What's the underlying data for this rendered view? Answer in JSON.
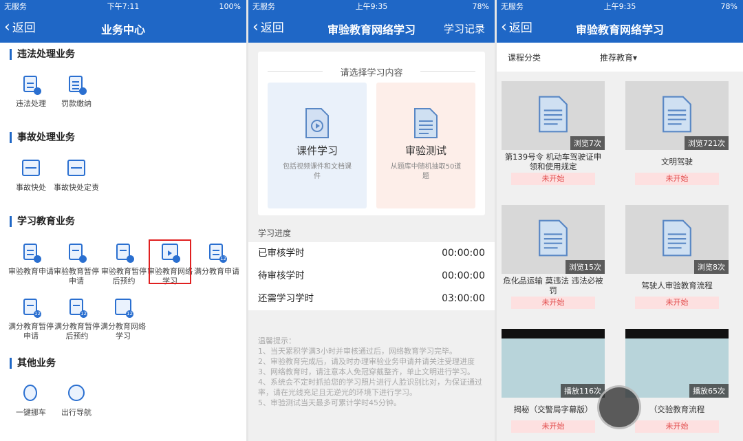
{
  "watermark": "youchejiuxing.com 有车就行",
  "s1": {
    "status": {
      "carrier": "无服务",
      "time": "下午7:11",
      "battery": "100%"
    },
    "nav": {
      "back": "返回",
      "title": "业务中心"
    },
    "sections": [
      {
        "title": "违法处理业务",
        "items": [
          "违法处理",
          "罚款缴纳"
        ]
      },
      {
        "title": "事故处理业务",
        "items": [
          "事故快处",
          "事故快处定责"
        ]
      },
      {
        "title": "学习教育业务",
        "items": [
          "审验教育申请",
          "审验教育暂停申请",
          "审验教育暂停后预约",
          "审验教育网络学习",
          "满分教育申请",
          "满分教育暂停申请",
          "满分教育暂停后预约",
          "满分教育网络学习"
        ]
      },
      {
        "title": "其他业务",
        "items": [
          "一键挪车",
          "出行导航"
        ]
      }
    ]
  },
  "s2": {
    "status": {
      "carrier": "无服务",
      "time": "上午9:35",
      "battery": "78%"
    },
    "nav": {
      "back": "返回",
      "title": "审验教育网络学习",
      "right": "学习记录"
    },
    "choose": "请选择学习内容",
    "options": [
      {
        "title": "课件学习",
        "desc": "包括视频课件和文档课件"
      },
      {
        "title": "审验测试",
        "desc": "从题库中随机抽取50道题"
      }
    ],
    "progress_label": "学习进度",
    "rows": [
      {
        "label": "已审核学时",
        "value": "00:00:00"
      },
      {
        "label": "待审核学时",
        "value": "00:00:00"
      },
      {
        "label": "还需学习学时",
        "value": "03:00:00"
      }
    ],
    "tips": [
      "温馨提示：",
      "1、当天累积学满3小时并审核通过后，网络教育学习完毕。",
      "2、审验教育完成后，请及时办理审验业务申请并请关注受理进度",
      "3、网络教育时，请注意本人免冠穿戴整齐，单止文明进行学习。",
      "4、系统会不定时抓拍您的学习照片进行人脸识别比对，为保证通过率，请在光线充足且无逆光的环境下进行学习。",
      "5、审验测试当天最多可累计学时45分钟。"
    ]
  },
  "s3": {
    "status": {
      "carrier": "无服务",
      "time": "上午9:35",
      "battery": "78%"
    },
    "nav": {
      "back": "返回",
      "title": "审验教育网络学习"
    },
    "filter": {
      "category": "课程分类",
      "recommend": "推荐教育▾"
    },
    "courses": [
      {
        "views": "浏览7次",
        "title": "第139号令 机动车驾驶证申领和使用规定",
        "status": "未开始",
        "type": "doc"
      },
      {
        "views": "浏览721次",
        "title": "文明驾驶",
        "status": "未开始",
        "type": "doc"
      },
      {
        "views": "浏览15次",
        "title": "危化品运输 莫违法 违法必被罚",
        "status": "未开始",
        "type": "doc"
      },
      {
        "views": "浏览8次",
        "title": "驾驶人审验教育流程",
        "status": "未开始",
        "type": "doc"
      },
      {
        "views": "播放116次",
        "title": "揭秘（交警局字幕版）",
        "status": "未开始",
        "type": "video"
      },
      {
        "views": "播放65次",
        "title": "（交验教育流程",
        "status": "未开始",
        "type": "video"
      }
    ]
  },
  "colors": {
    "primary": "#1f67c6",
    "highlight": "#e02020",
    "status_bg": "#fde0e0"
  }
}
